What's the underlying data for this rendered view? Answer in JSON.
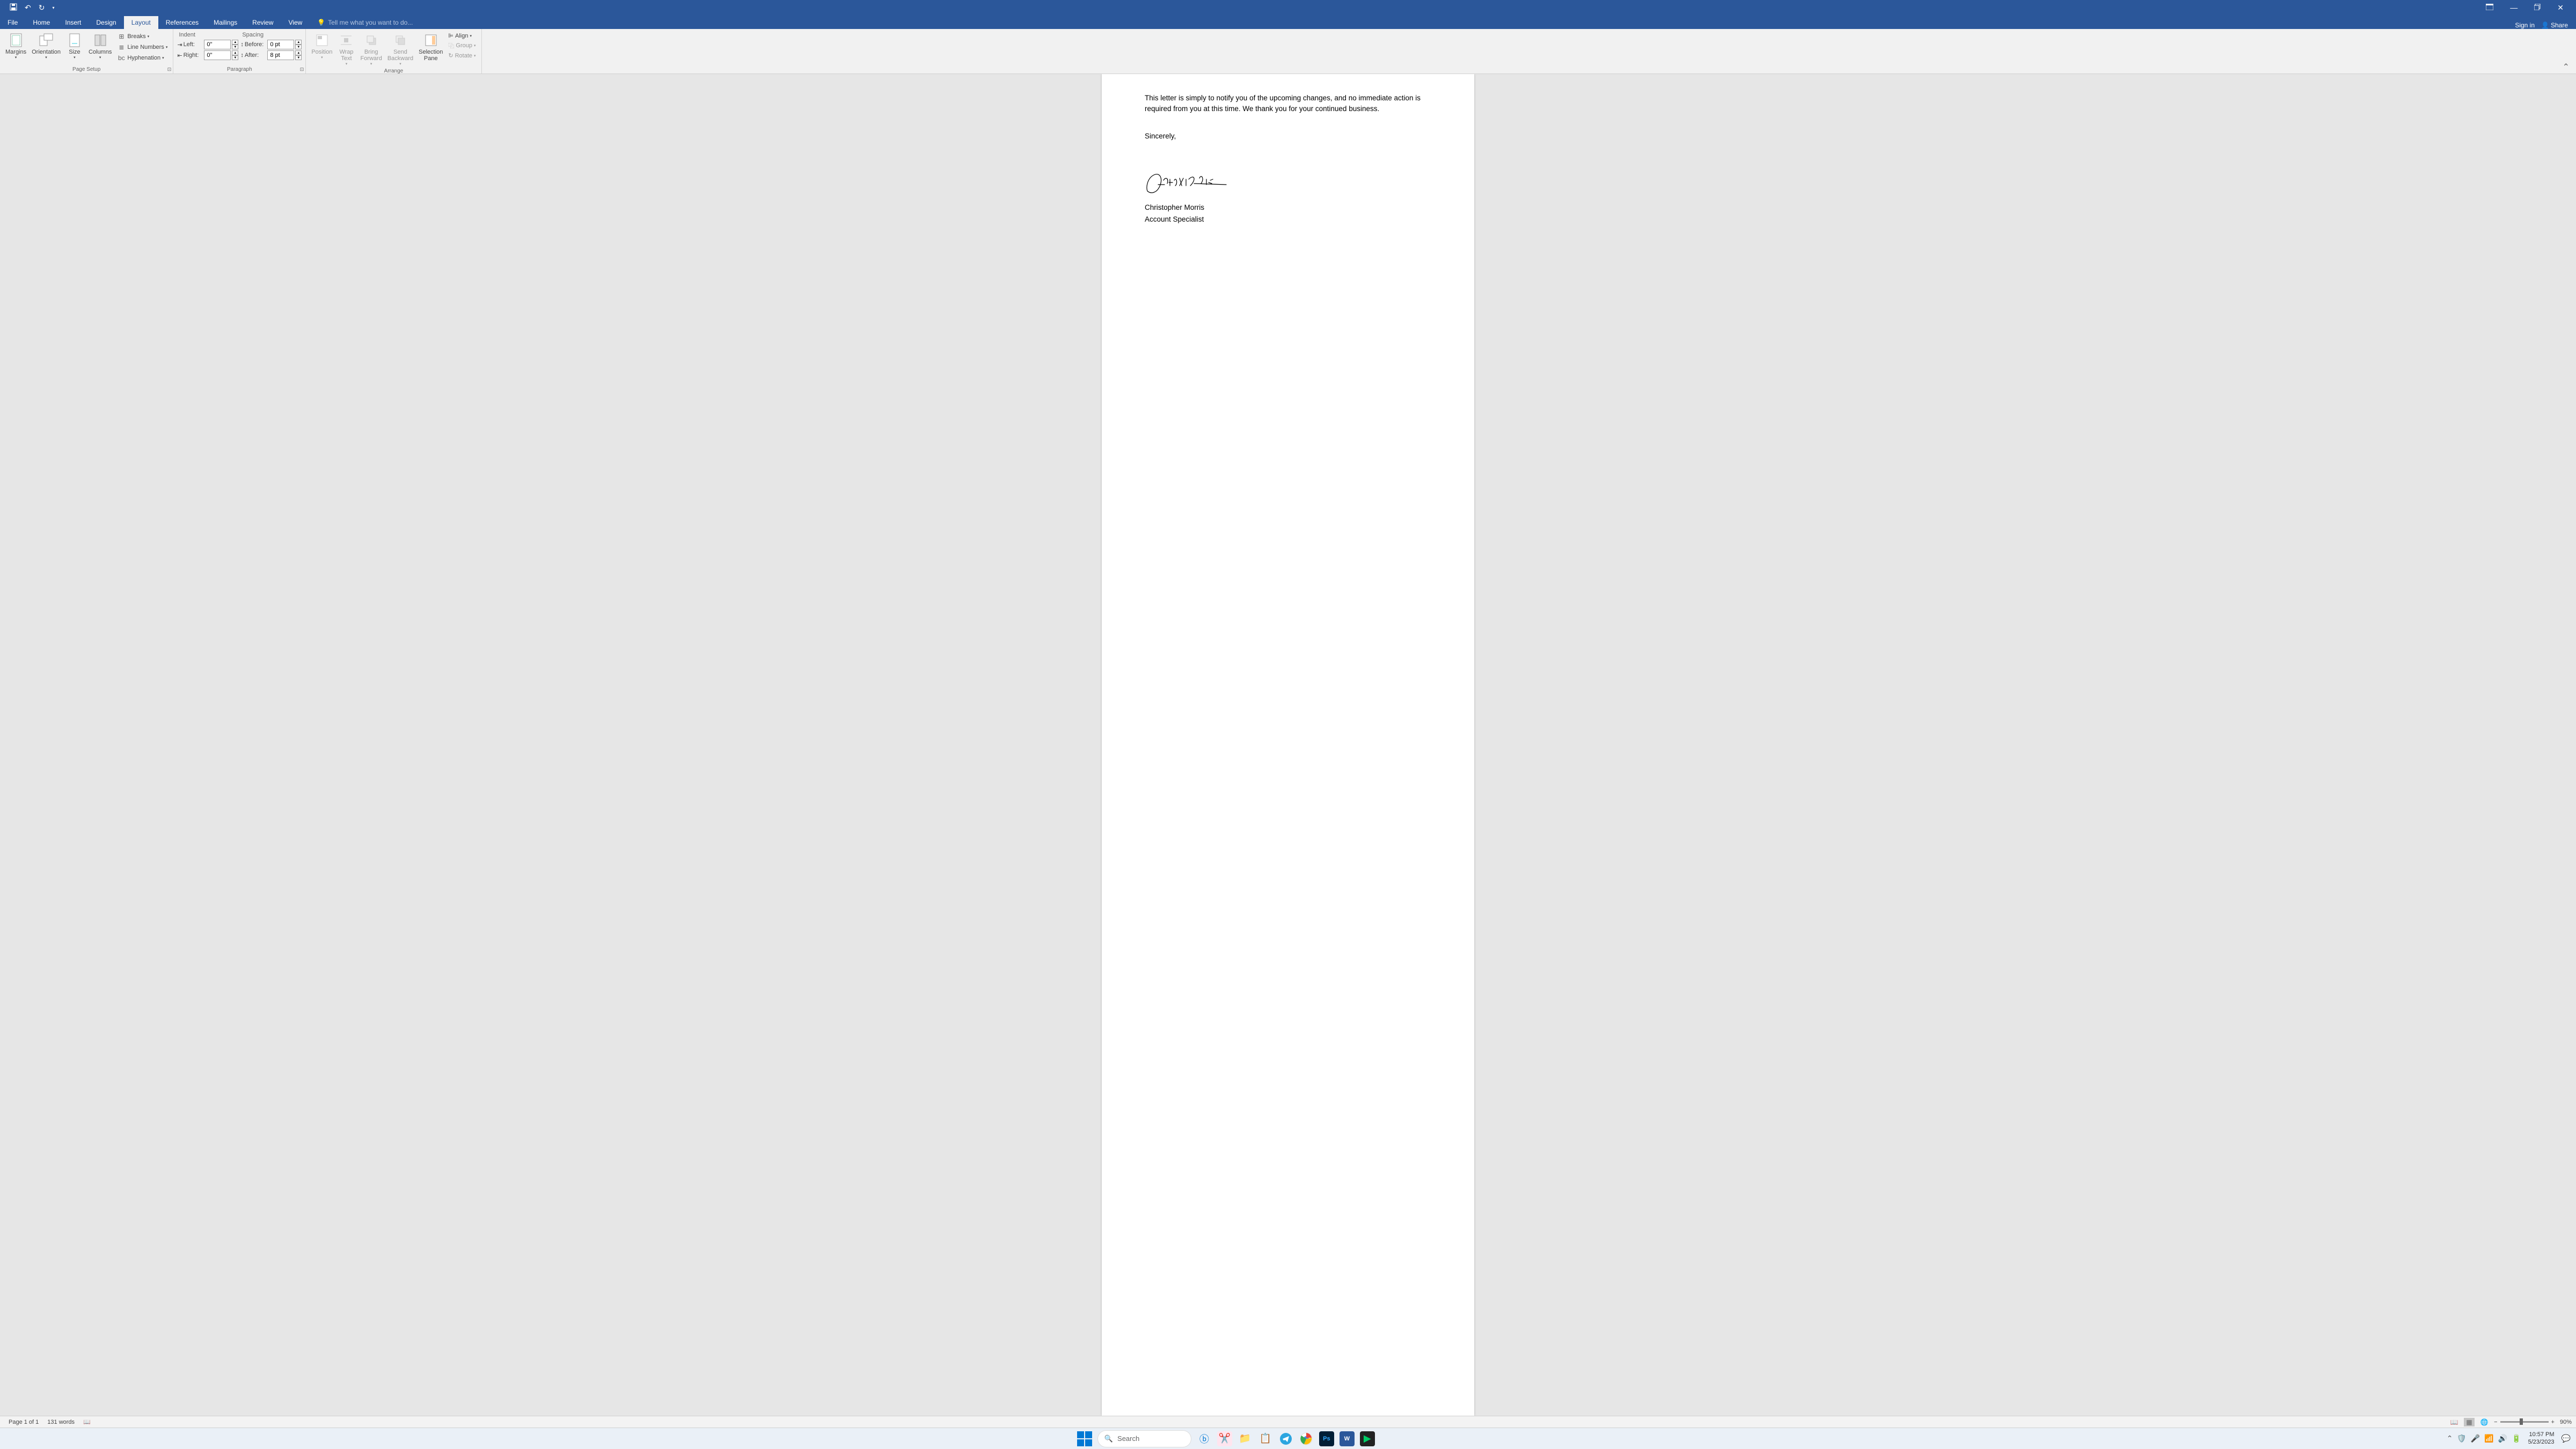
{
  "qat": {
    "save": "💾",
    "undo": "↶",
    "redo": "↻",
    "customize": "▾"
  },
  "window_controls": {
    "ribbon_options": "⬚",
    "minimize": "—",
    "maximize": "⧉",
    "close": "✕"
  },
  "tabs": {
    "file": "File",
    "home": "Home",
    "insert": "Insert",
    "design": "Design",
    "layout": "Layout",
    "references": "References",
    "mailings": "Mailings",
    "review": "Review",
    "view": "View"
  },
  "tell_me": "Tell me what you want to do...",
  "sign_in": "Sign in",
  "share": "Share",
  "ribbon": {
    "page_setup": {
      "margins": "Margins",
      "orientation": "Orientation",
      "size": "Size",
      "columns": "Columns",
      "breaks": "Breaks",
      "line_numbers": "Line Numbers",
      "hyphenation": "Hyphenation",
      "label": "Page Setup"
    },
    "indent": {
      "header": "Indent",
      "left_label": "Left:",
      "left_value": "0\"",
      "right_label": "Right:",
      "right_value": "0\""
    },
    "spacing": {
      "header": "Spacing",
      "before_label": "Before:",
      "before_value": "0 pt",
      "after_label": "After:",
      "after_value": "8 pt"
    },
    "paragraph_label": "Paragraph",
    "arrange": {
      "position": "Position",
      "wrap_text": "Wrap\nText",
      "bring_forward": "Bring\nForward",
      "send_backward": "Send\nBackward",
      "selection_pane": "Selection\nPane",
      "align": "Align",
      "group": "Group",
      "rotate": "Rotate",
      "label": "Arrange"
    }
  },
  "document": {
    "paragraph1": "This letter is simply to notify you of the upcoming changes, and no immediate action is required from you at this time. We thank you for your continued business.",
    "closing": "Sincerely,",
    "name": "Christopher Morris",
    "title": "Account Specialist"
  },
  "status": {
    "page": "Page 1 of 1",
    "words": "131 words",
    "zoom": "90%"
  },
  "taskbar": {
    "search": "Search",
    "time": "10:57 PM",
    "date": "5/23/2023"
  }
}
